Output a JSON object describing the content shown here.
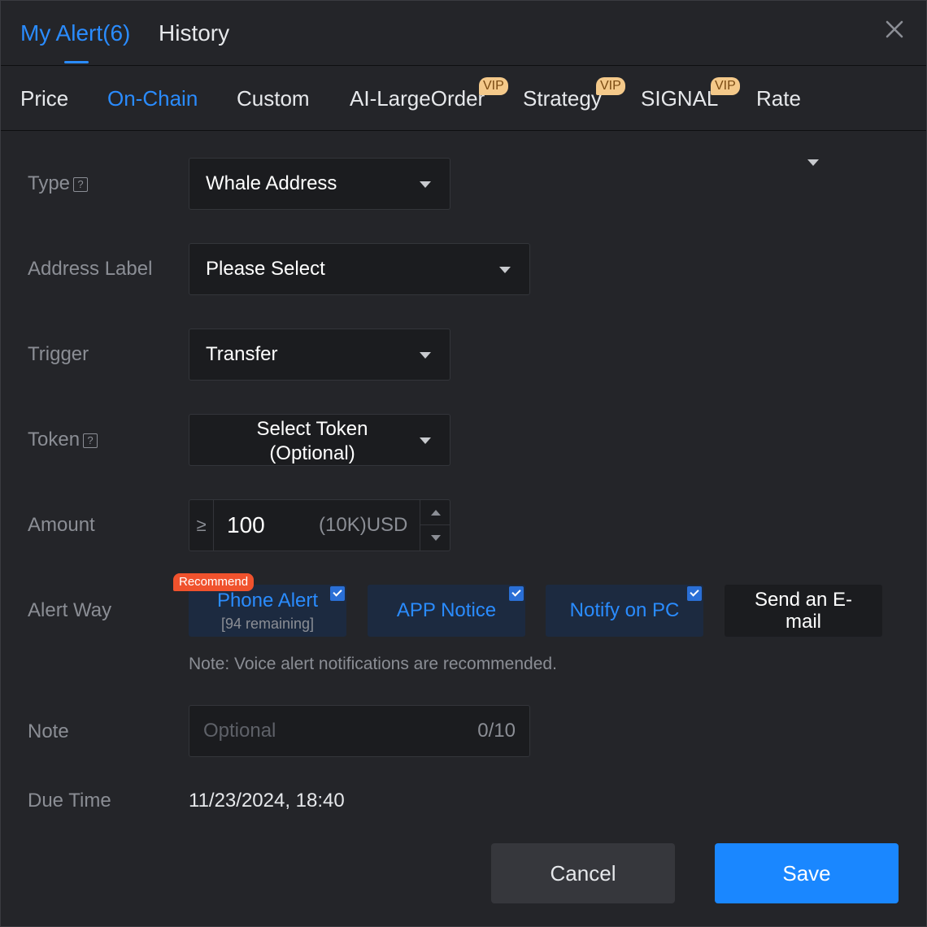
{
  "header": {
    "tabs": [
      {
        "label": "My Alert(6)"
      },
      {
        "label": "History"
      }
    ]
  },
  "subtabs": {
    "items": [
      {
        "label": "Price"
      },
      {
        "label": "On-Chain"
      },
      {
        "label": "Custom"
      },
      {
        "label": "AI-LargeOrder",
        "badge": "VIP"
      },
      {
        "label": "Strategy",
        "badge": "VIP"
      },
      {
        "label": "SIGNAL",
        "badge": "VIP"
      },
      {
        "label": "Rate"
      }
    ]
  },
  "form": {
    "type": {
      "label": "Type",
      "value": "Whale Address"
    },
    "address_label": {
      "label": "Address Label",
      "value": "Please Select"
    },
    "trigger": {
      "label": "Trigger",
      "value": "Transfer"
    },
    "token": {
      "label": "Token",
      "value_line1": "Select Token",
      "value_line2": "(Optional)"
    },
    "amount": {
      "label": "Amount",
      "operator": "≥",
      "value": "100",
      "unit": "(10K)USD"
    },
    "alert_way": {
      "label": "Alert Way",
      "recommend_badge": "Recommend",
      "phone": {
        "label": "Phone Alert",
        "sub": "[94 remaining]",
        "checked": true
      },
      "app": {
        "label": "APP Notice",
        "checked": true
      },
      "pc": {
        "label": "Notify on PC",
        "checked": true
      },
      "email": {
        "label_line1": "Send an E-",
        "label_line2": "mail",
        "checked": false
      },
      "note": "Note: Voice alert notifications are recommended."
    },
    "note": {
      "label": "Note",
      "placeholder": "Optional",
      "count": "0/10"
    },
    "due_time": {
      "label": "Due Time",
      "value": "11/23/2024, 18:40"
    }
  },
  "buttons": {
    "cancel": "Cancel",
    "save": "Save"
  },
  "colors": {
    "accent": "#2a8cff",
    "vip": "#f4c98a",
    "recommend": "#f0522d",
    "save": "#1a87ff"
  }
}
